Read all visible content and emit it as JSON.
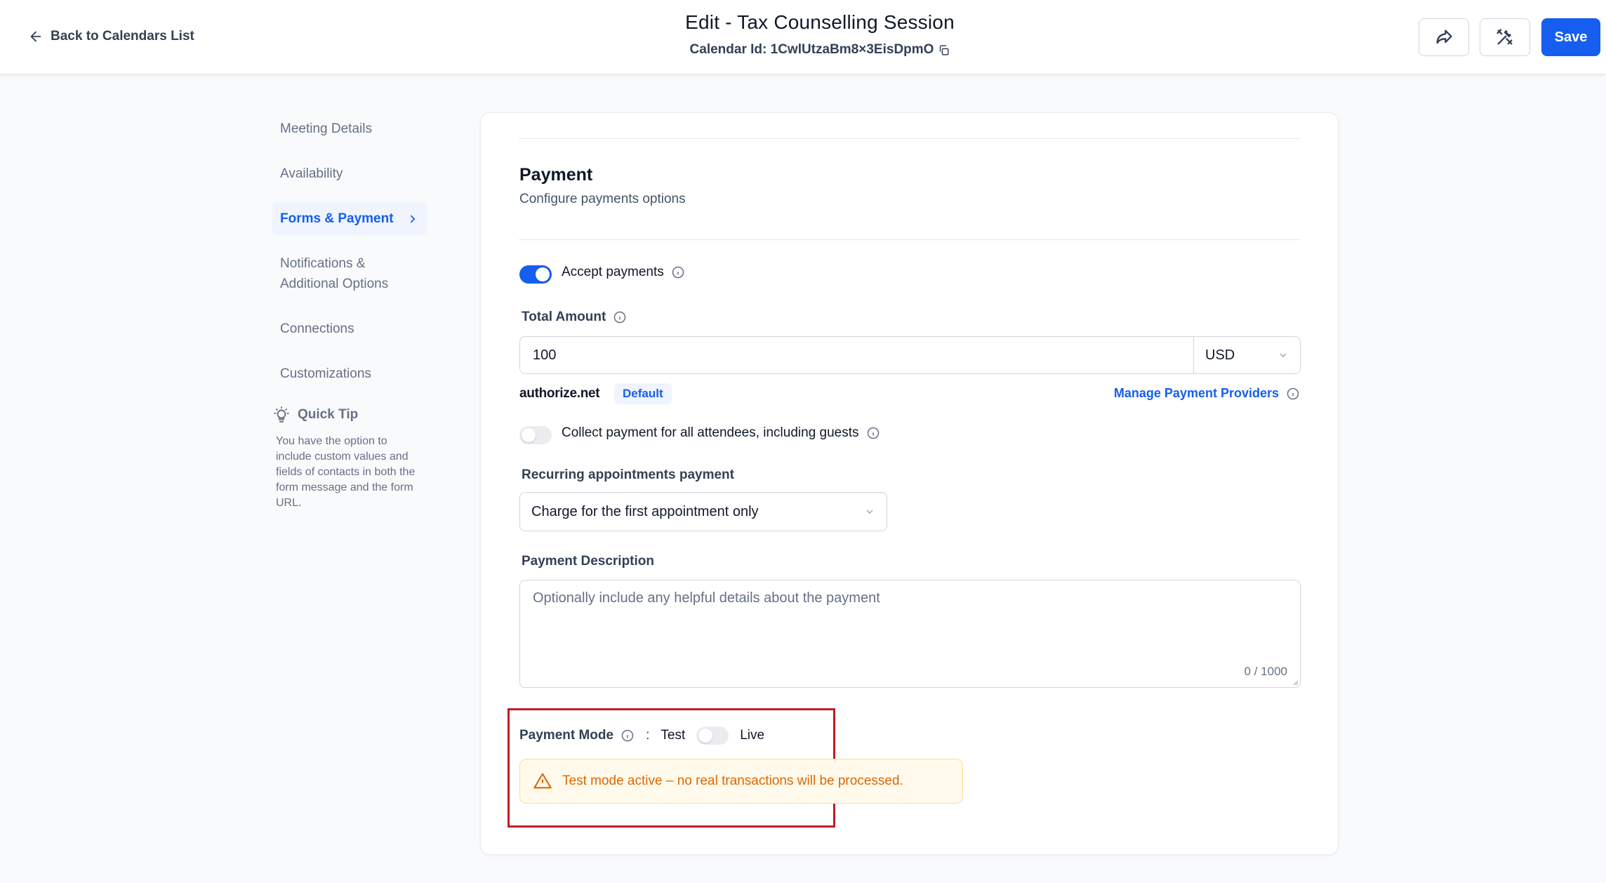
{
  "header": {
    "back_label": "Back to Calendars List",
    "title": "Edit - Tax Counselling Session",
    "calendar_id_label": "Calendar Id: 1CwlUtzaBm8×3EisDpmO",
    "save_label": "Save"
  },
  "sidebar": {
    "items": [
      {
        "label": "Meeting Details"
      },
      {
        "label": "Availability"
      },
      {
        "label": "Forms & Payment"
      },
      {
        "label": "Notifications & Additional Options"
      },
      {
        "label": "Connections"
      },
      {
        "label": "Customizations"
      }
    ],
    "active_index": 2,
    "quick_tip": {
      "title": "Quick Tip",
      "body": "You have the option to include custom values and fields of contacts in both the form message and the form URL."
    }
  },
  "payment": {
    "title": "Payment",
    "subtitle": "Configure payments options",
    "accept_payments_label": "Accept payments",
    "accept_payments_on": true,
    "total_amount_label": "Total Amount",
    "total_amount_value": "100",
    "currency": "USD",
    "provider_name": "authorize.net",
    "provider_badge": "Default",
    "manage_providers_label": "Manage Payment Providers",
    "collect_all_label": "Collect payment for all attendees, including guests",
    "collect_all_on": false,
    "recurring_label": "Recurring appointments payment",
    "recurring_value": "Charge for the first appointment only",
    "description_label": "Payment Description",
    "description_placeholder": "Optionally include any helpful details about the payment",
    "description_counter": "0 / 1000",
    "mode_label": "Payment Mode",
    "mode_separator": ":",
    "mode_test": "Test",
    "mode_live": "Live",
    "mode_live_on": false,
    "test_alert": "Test mode active – no real transactions will be processed."
  },
  "colors": {
    "accent": "#155eef",
    "warning_text": "#dc6803",
    "warning_bg": "#fffaeb",
    "highlight": "#c01d24"
  }
}
